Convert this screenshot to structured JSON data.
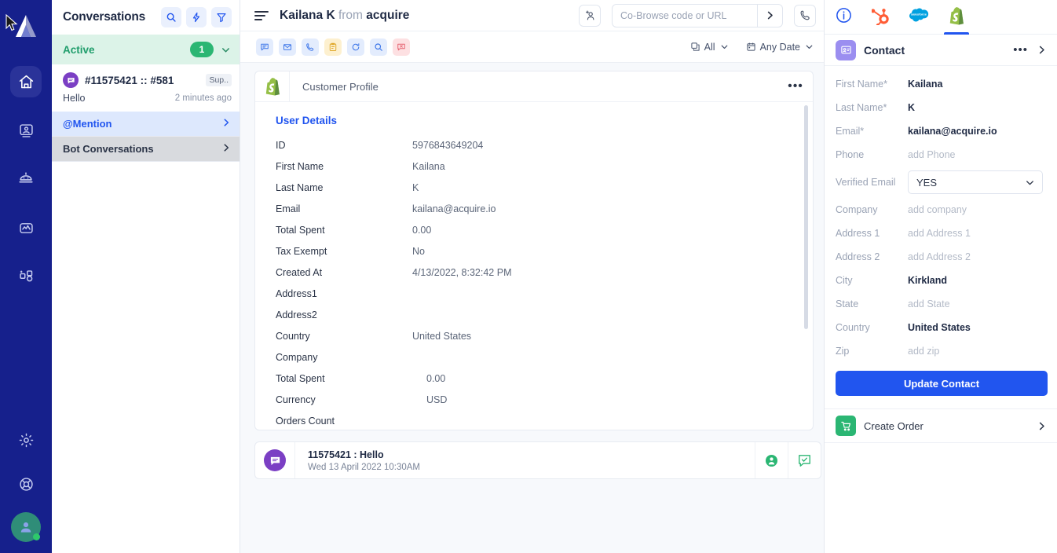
{
  "rail": {
    "logo": "acquire-logo",
    "items": [
      {
        "name": "home",
        "icon": "home-icon",
        "active": true
      },
      {
        "name": "contacts",
        "icon": "contact-card-icon",
        "active": false
      },
      {
        "name": "bot",
        "icon": "robot-icon",
        "active": false
      },
      {
        "name": "analytics",
        "icon": "analytics-icon",
        "active": false
      },
      {
        "name": "apps",
        "icon": "add-apps-icon",
        "active": false
      }
    ],
    "bottom": [
      {
        "name": "settings",
        "icon": "gear-icon"
      },
      {
        "name": "help",
        "icon": "lifebuoy-icon"
      },
      {
        "name": "profile",
        "icon": "avatar-icon"
      }
    ]
  },
  "conversations": {
    "title": "Conversations",
    "header_buttons": [
      {
        "name": "search",
        "icon": "search-icon"
      },
      {
        "name": "quick-actions",
        "icon": "bolt-icon"
      },
      {
        "name": "filter",
        "icon": "funnel-icon"
      }
    ],
    "active_section": {
      "label": "Active",
      "count": "1",
      "chevron": "chevron-down-icon"
    },
    "items": [
      {
        "id": "#11575421 :: #581",
        "tag": "Sup..",
        "message": "Hello",
        "time": "2 minutes ago",
        "avatar_icon": "chat-bubble-icon"
      }
    ],
    "sections": [
      {
        "label": "@Mention",
        "style": "mention",
        "chevron": "chevron-right-icon"
      },
      {
        "label": "Bot Conversations",
        "style": "bot",
        "chevron": "chevron-right-icon"
      }
    ]
  },
  "main": {
    "menu_icon": "hamburger-icon",
    "title_name": "Kailana K",
    "title_from": "from",
    "title_brand": "acquire",
    "add_user_icon": "add-user-icon",
    "cobrowse": {
      "placeholder": "Co-Browse code or URL",
      "value": "",
      "go_icon": "chevron-right-icon"
    },
    "call_icon": "phone-icon",
    "tools": [
      {
        "name": "chat",
        "icon": "chat-icon",
        "style": "blue"
      },
      {
        "name": "email",
        "icon": "envelope-icon",
        "style": "blue"
      },
      {
        "name": "call",
        "icon": "phone-icon",
        "style": "blue"
      },
      {
        "name": "notes",
        "icon": "clipboard-icon",
        "style": "yellow"
      },
      {
        "name": "refresh",
        "icon": "refresh-icon",
        "style": "blue"
      },
      {
        "name": "search",
        "icon": "search-icon",
        "style": "blue"
      },
      {
        "name": "missed-chat",
        "icon": "chat-x-icon",
        "style": "red"
      }
    ],
    "filters": [
      {
        "name": "type-filter",
        "icon": "copy-icon",
        "label": "All",
        "chevron": "chevron-down-icon"
      },
      {
        "name": "date-filter",
        "icon": "calendar-icon",
        "label": "Any Date",
        "chevron": "chevron-down-icon"
      }
    ]
  },
  "profile_card": {
    "logo_icon": "shopify-icon",
    "title": "Customer Profile",
    "menu_icon": "ellipsis-icon",
    "section_title": "User Details",
    "rows": [
      {
        "key": "ID",
        "value": "5976843649204"
      },
      {
        "key": "First Name",
        "value": "Kailana"
      },
      {
        "key": "Last Name",
        "value": "K"
      },
      {
        "key": "Email",
        "value": "kailana@acquire.io"
      },
      {
        "key": "Total Spent",
        "value": "0.00"
      },
      {
        "key": "Tax Exempt",
        "value": "No"
      },
      {
        "key": "Created At",
        "value": "4/13/2022, 8:32:42 PM"
      },
      {
        "key": "Address1",
        "value": ""
      },
      {
        "key": "Address2",
        "value": ""
      },
      {
        "key": "Country",
        "value": "United States"
      },
      {
        "key": "Company",
        "value": ""
      },
      {
        "key": "Total Spent",
        "value": "0.00"
      },
      {
        "key": "Currency",
        "value": "USD"
      },
      {
        "key": "Orders Count",
        "value": ""
      }
    ]
  },
  "message_card": {
    "avatar_icon": "chat-bubble-icon",
    "title": "11575421 : Hello",
    "timestamp": "Wed 13 April 2022 10:30AM",
    "actions": [
      {
        "name": "assign-agent",
        "icon": "user-filled-icon"
      },
      {
        "name": "resolve-chat",
        "icon": "chat-check-icon"
      }
    ]
  },
  "right_panel": {
    "tabs": [
      {
        "name": "info",
        "icon": "info-icon",
        "active": false
      },
      {
        "name": "hubspot",
        "icon": "hubspot-icon",
        "active": false
      },
      {
        "name": "salesforce",
        "icon": "salesforce-icon",
        "active": false
      },
      {
        "name": "shopify",
        "icon": "shopify-icon",
        "active": true
      }
    ],
    "contact": {
      "icon": "contact-card-icon",
      "title": "Contact",
      "menu_icon": "ellipsis-icon",
      "expand_icon": "chevron-right-icon",
      "fields": [
        {
          "key": "First Name*",
          "value": "Kailana",
          "placeholder": false
        },
        {
          "key": "Last Name*",
          "value": "K",
          "placeholder": false
        },
        {
          "key": "Email*",
          "value": "kailana@acquire.io",
          "placeholder": false
        },
        {
          "key": "Phone",
          "value": "add Phone",
          "placeholder": true
        }
      ],
      "verified_email": {
        "key": "Verified Email",
        "value": "YES",
        "chevron": "chevron-down-icon"
      },
      "fields2": [
        {
          "key": "Company",
          "value": "add company",
          "placeholder": true
        },
        {
          "key": "Address 1",
          "value": "add Address 1",
          "placeholder": true
        },
        {
          "key": "Address 2",
          "value": "add Address 2",
          "placeholder": true
        },
        {
          "key": "City",
          "value": "Kirkland",
          "placeholder": false
        },
        {
          "key": "State",
          "value": "add State",
          "placeholder": true
        },
        {
          "key": "Country",
          "value": "United States",
          "placeholder": false
        },
        {
          "key": "Zip",
          "value": "add zip",
          "placeholder": true
        }
      ],
      "update_button": "Update Contact"
    },
    "create_order": {
      "icon": "cart-icon",
      "label": "Create Order",
      "chevron": "chevron-right-icon"
    }
  },
  "colors": {
    "rail_bg": "#16208c",
    "accent_blue": "#2155ef",
    "green": "#2bb673",
    "active_bg": "#dcf3e8",
    "purple": "#7b3fc4"
  }
}
